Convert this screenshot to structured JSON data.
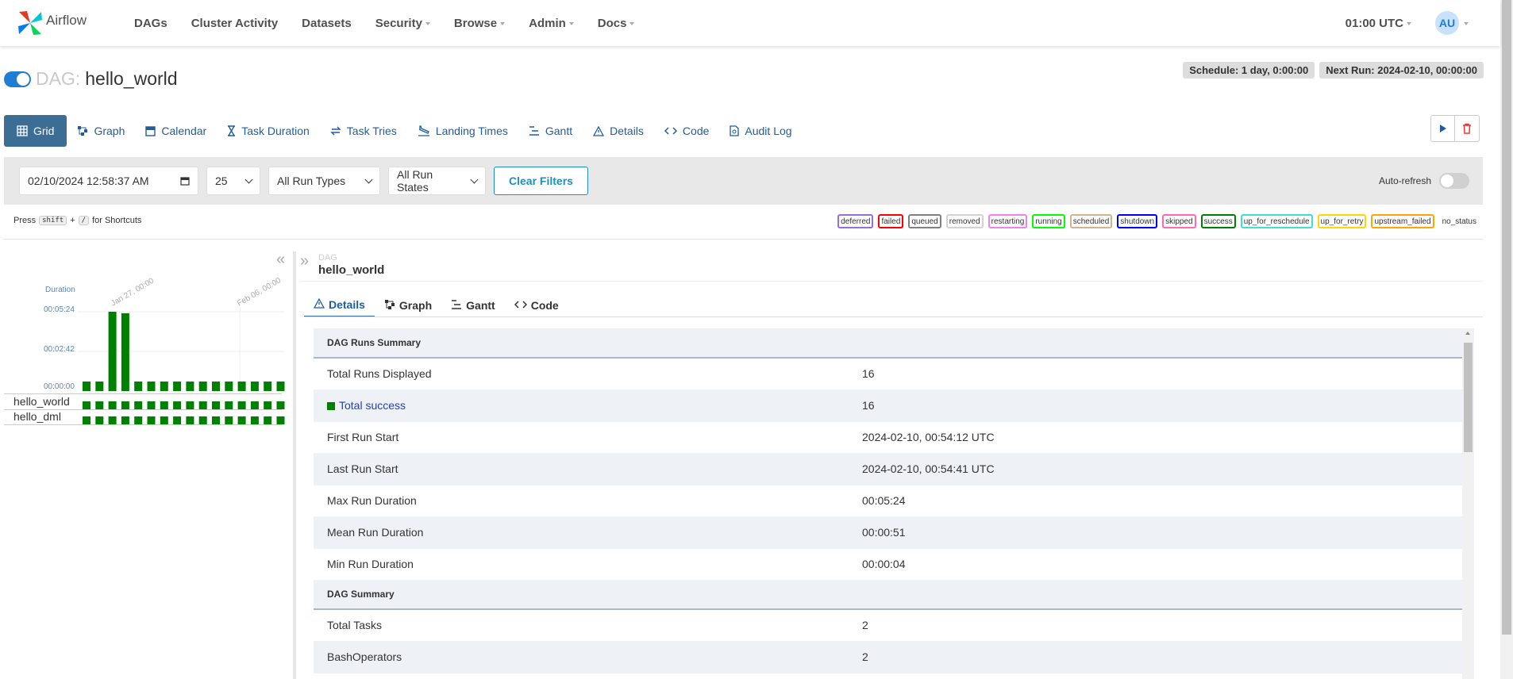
{
  "navbar": {
    "brand": "Airflow",
    "items": [
      {
        "label": "DAGs",
        "dropdown": false
      },
      {
        "label": "Cluster Activity",
        "dropdown": false
      },
      {
        "label": "Datasets",
        "dropdown": false
      },
      {
        "label": "Security",
        "dropdown": true
      },
      {
        "label": "Browse",
        "dropdown": true
      },
      {
        "label": "Admin",
        "dropdown": true
      },
      {
        "label": "Docs",
        "dropdown": true
      }
    ],
    "time": "01:00 UTC",
    "avatar": "AU"
  },
  "dag": {
    "label": "DAG:",
    "name": "hello_world",
    "schedule": "Schedule: 1 day, 0:00:00",
    "next_run": "Next Run: 2024-02-10, 00:00:00"
  },
  "view_tabs": [
    {
      "label": "Grid",
      "icon": "grid-icon",
      "active": true
    },
    {
      "label": "Graph",
      "icon": "graph-icon"
    },
    {
      "label": "Calendar",
      "icon": "calendar-icon"
    },
    {
      "label": "Task Duration",
      "icon": "hourglass-icon"
    },
    {
      "label": "Task Tries",
      "icon": "retry-icon"
    },
    {
      "label": "Landing Times",
      "icon": "plane-icon"
    },
    {
      "label": "Gantt",
      "icon": "gantt-icon"
    },
    {
      "label": "Details",
      "icon": "warning-icon"
    },
    {
      "label": "Code",
      "icon": "code-icon"
    },
    {
      "label": "Audit Log",
      "icon": "audit-icon"
    }
  ],
  "filters": {
    "date": "02/10/2024 12:58:37 AM",
    "num_runs": "25",
    "run_types": "All Run Types",
    "run_states": "All Run States",
    "clear": "Clear Filters",
    "auto_refresh": "Auto-refresh"
  },
  "shortcuts": {
    "press": "Press",
    "key1": "shift",
    "plus": "+",
    "key2": "/",
    "suffix": "for Shortcuts"
  },
  "legend": [
    {
      "label": "deferred",
      "color": "#9370db"
    },
    {
      "label": "failed",
      "color": "#ff0000"
    },
    {
      "label": "queued",
      "color": "#808080"
    },
    {
      "label": "removed",
      "color": "#d3d3d3"
    },
    {
      "label": "restarting",
      "color": "#ee82ee"
    },
    {
      "label": "running",
      "color": "#00ff00"
    },
    {
      "label": "scheduled",
      "color": "#d2b48c"
    },
    {
      "label": "shutdown",
      "color": "#0000ff"
    },
    {
      "label": "skipped",
      "color": "#ff69b4"
    },
    {
      "label": "success",
      "color": "#008000"
    },
    {
      "label": "up_for_reschedule",
      "color": "#40e0d0"
    },
    {
      "label": "up_for_retry",
      "color": "#ffd700"
    },
    {
      "label": "upstream_failed",
      "color": "#ffa500"
    },
    {
      "label": "no_status",
      "color": "transparent"
    }
  ],
  "grid": {
    "duration_label": "Duration",
    "y_ticks": [
      "00:05:24",
      "00:02:42",
      "00:00:00"
    ],
    "date_ticks": [
      "Jan 27, 00:00",
      "Feb 06, 00:00"
    ],
    "tasks": [
      "hello_world",
      "hello_dml"
    ]
  },
  "chart_data": {
    "type": "bar",
    "ylabel": "Duration",
    "ylim": [
      0,
      324
    ],
    "y_unit": "seconds",
    "values": [
      4,
      4,
      324,
      318,
      4,
      4,
      4,
      4,
      4,
      4,
      4,
      4,
      4,
      4,
      4,
      4
    ],
    "color": "#008000"
  },
  "details": {
    "crumb_sub": "DAG",
    "crumb_main": "hello_world",
    "tabs": [
      {
        "label": "Details",
        "icon": "warning-icon",
        "active": true
      },
      {
        "label": "Graph",
        "icon": "graph-icon"
      },
      {
        "label": "Gantt",
        "icon": "gantt-icon"
      },
      {
        "label": "Code",
        "icon": "code-icon"
      }
    ],
    "runs_summary_title": "DAG Runs Summary",
    "runs_summary": [
      {
        "key": "Total Runs Displayed",
        "value": "16"
      },
      {
        "key": "Total success",
        "value": "16",
        "state": "success"
      },
      {
        "key": "First Run Start",
        "value": "2024-02-10, 00:54:12 UTC"
      },
      {
        "key": "Last Run Start",
        "value": "2024-02-10, 00:54:41 UTC"
      },
      {
        "key": "Max Run Duration",
        "value": "00:05:24"
      },
      {
        "key": "Mean Run Duration",
        "value": "00:00:51"
      },
      {
        "key": "Min Run Duration",
        "value": "00:00:04"
      }
    ],
    "dag_summary_title": "DAG Summary",
    "dag_summary": [
      {
        "key": "Total Tasks",
        "value": "2"
      },
      {
        "key": "BashOperators",
        "value": "2"
      }
    ]
  }
}
